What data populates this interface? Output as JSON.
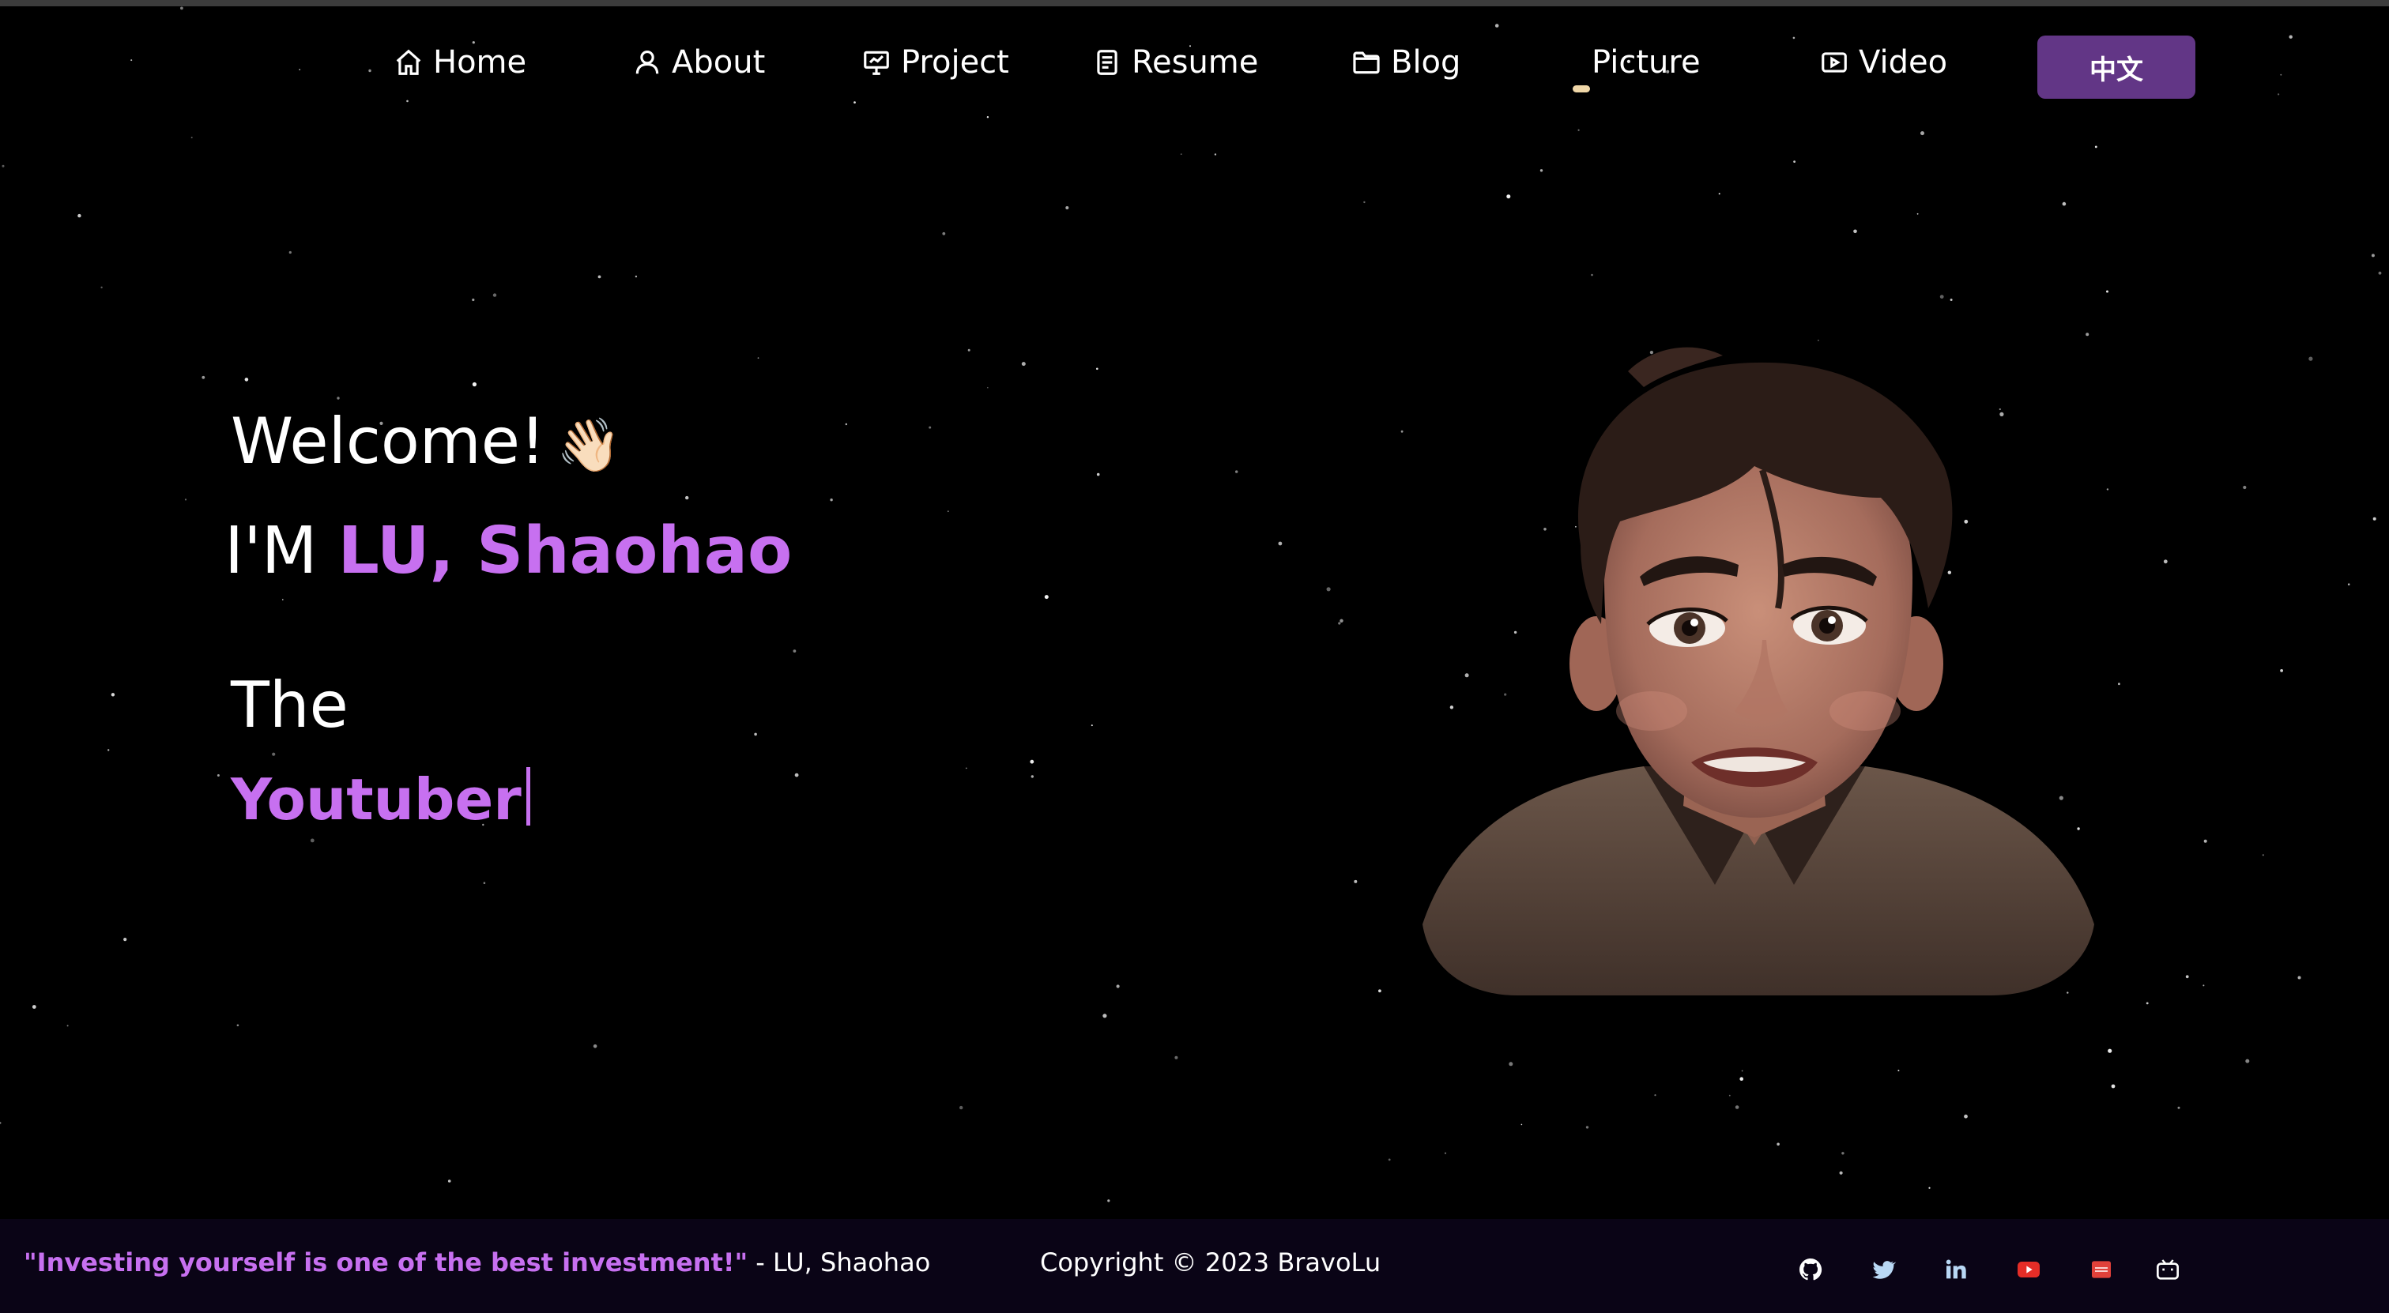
{
  "nav": {
    "home": "Home",
    "about": "About",
    "project": "Project",
    "resume": "Resume",
    "blog": "Blog",
    "picture": "Picture",
    "video": "Video",
    "language_button": "中文"
  },
  "hero": {
    "welcome": "Welcome!",
    "wave_emoji": "👋🏻",
    "im_prefix": "I'M",
    "name": "LU, Shaohao",
    "the": "The",
    "role": "Youtuber"
  },
  "footer": {
    "quote": "\"Investing yourself is one of the best investment!\"",
    "quote_author": "- LU, Shaohao",
    "copyright": "Copyright © 2023 BravoLu",
    "social_icons": [
      "github-icon",
      "twitter-icon",
      "linkedin-icon",
      "youtube-icon",
      "video-site-icon",
      "bilibili-icon"
    ]
  },
  "colors": {
    "accent": "#c770f0",
    "language_button": "#623686",
    "background": "#000000",
    "footer_background": "#0a0416"
  }
}
